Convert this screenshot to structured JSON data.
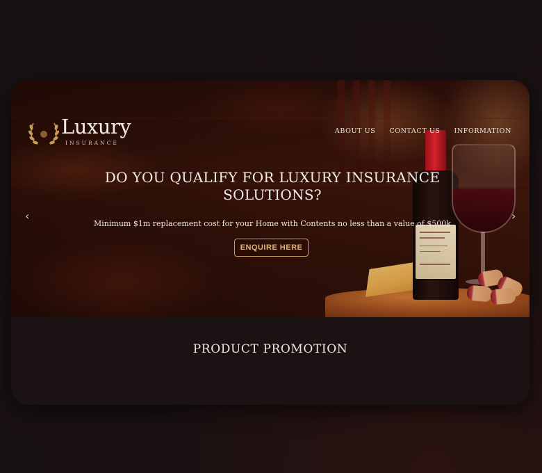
{
  "brand": {
    "name": "Luxury",
    "tagline": "INSURANCE"
  },
  "nav": {
    "items": [
      {
        "label": "ABOUT US"
      },
      {
        "label": "CONTACT US"
      },
      {
        "label": "INFORMATION"
      }
    ]
  },
  "hero": {
    "title": "DO YOU QUALIFY FOR LUXURY INSURANCE SOLUTIONS?",
    "subtitle": "Minimum $1m replacement cost for your Home with Contents no less than a value of $500k",
    "cta_label": "ENQUIRE HERE",
    "prev_arrow": "‹",
    "next_arrow": "›"
  },
  "section": {
    "title": "PRODUCT PROMOTION"
  },
  "colors": {
    "accent": "#c9a06a",
    "card_bg": "#1b1313",
    "page_bg": "#171214"
  }
}
